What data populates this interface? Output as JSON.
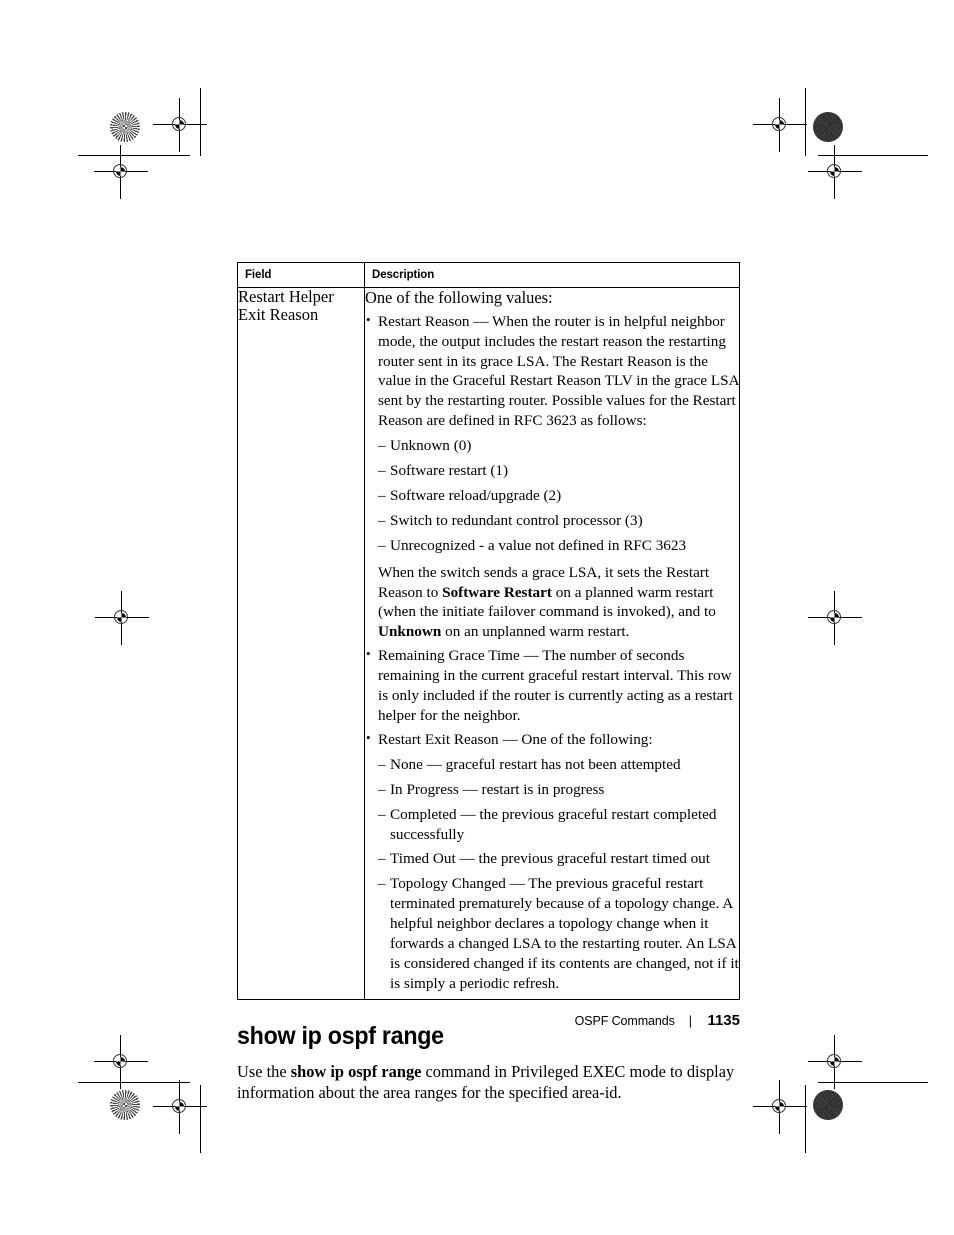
{
  "table": {
    "headers": [
      "Field",
      "Description"
    ],
    "row": {
      "field": "Restart Helper\nExit Reason",
      "field_line1": "Restart Helper",
      "field_line2": "Exit Reason",
      "lead": "One of the following values:",
      "bullet1": {
        "term": "Restart Reason",
        "dash": "—",
        "text": "When the router is in helpful neighbor mode, the output includes the restart reason the restarting router sent in its grace LSA. The Restart Reason is the value in the Graceful Restart Reason TLV in the grace LSA sent by the restarting router. Possible values for the Restart Reason are defined in RFC 3623 as follows:",
        "values": [
          "Unknown (0)",
          "Software restart (1)",
          "Software reload/upgrade (2)",
          "Switch to redundant control processor (3)",
          "Unrecognized - a value not defined in RFC 3623"
        ],
        "note_part1": "When the switch sends a grace LSA, it sets the Restart Reason to ",
        "note_bold1": "Software Restart",
        "note_part2": " on a planned warm restart (when the initiate failover command is invoked), and to ",
        "note_bold2": "Unknown",
        "note_part3": " on an unplanned warm restart."
      },
      "bullet2": {
        "term": "Remaining Grace Time",
        "dash": "—",
        "text": "The number of seconds remaining in the current graceful restart interval. This row is only included if the router is currently acting as a restart helper for the neighbor."
      },
      "bullet3": {
        "term": "Restart Exit Reason",
        "dash": "—",
        "text": "One of the following:",
        "values": [
          "None — graceful restart has not been attempted",
          "In Progress — restart is in progress",
          "Completed — the previous graceful restart completed successfully",
          "Timed Out — the previous graceful restart timed out",
          "Topology Changed — The previous graceful restart terminated prematurely because of a topology change. A helpful neighbor declares a topology change when it forwards a changed LSA to the restarting router. An LSA is considered changed if its contents are changed, not if it is simply a periodic refresh."
        ]
      }
    }
  },
  "section": {
    "heading": "show ip ospf range",
    "paragraph_part1": "Use the ",
    "paragraph_command": "show ip ospf range",
    "paragraph_part2": " command in Privileged EXEC mode to display information about the area ranges for the specified area-id."
  },
  "footer": {
    "chapter": "OSPF Commands",
    "separator": "|",
    "page_number": "1135"
  }
}
